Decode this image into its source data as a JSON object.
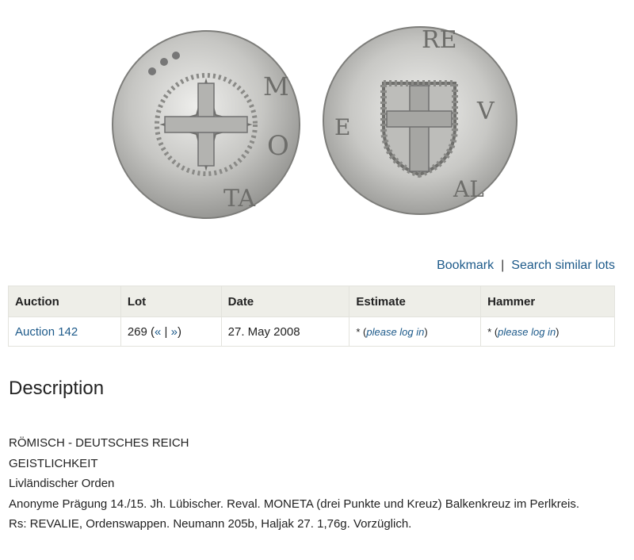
{
  "actions": {
    "bookmark": "Bookmark",
    "separator": "|",
    "search_similar": "Search similar lots"
  },
  "table": {
    "headers": [
      "Auction",
      "Lot",
      "Date",
      "Estimate",
      "Hammer"
    ],
    "row": {
      "auction": "Auction 142",
      "lot_number": "269 (",
      "lot_prev": "«",
      "lot_sep": " | ",
      "lot_next": "»",
      "lot_close": ")",
      "date": "27. May 2008",
      "estimate_prefix": "* (",
      "estimate_link": "please log in",
      "estimate_suffix": ")",
      "hammer_prefix": "* (",
      "hammer_link": "please log in",
      "hammer_suffix": ")"
    }
  },
  "description": {
    "title": "Description",
    "lines": [
      "RÖMISCH - DEUTSCHES REICH",
      "GEISTLICHKEIT",
      "Livländischer Orden",
      "Anonyme Prägung 14./15. Jh. Lübischer. Reval. MONETA (drei Punkte und Kreuz) Balkenkreuz im Perlkreis.",
      "Rs: REVALIE, Ordenswappen. Neumann 205b, Haljak 27. 1,76g. Vorzüglich."
    ]
  },
  "colors": {
    "link": "#1d5a8a",
    "header_bg": "#eeeee8",
    "coin_silver": "#c9c9c6"
  }
}
